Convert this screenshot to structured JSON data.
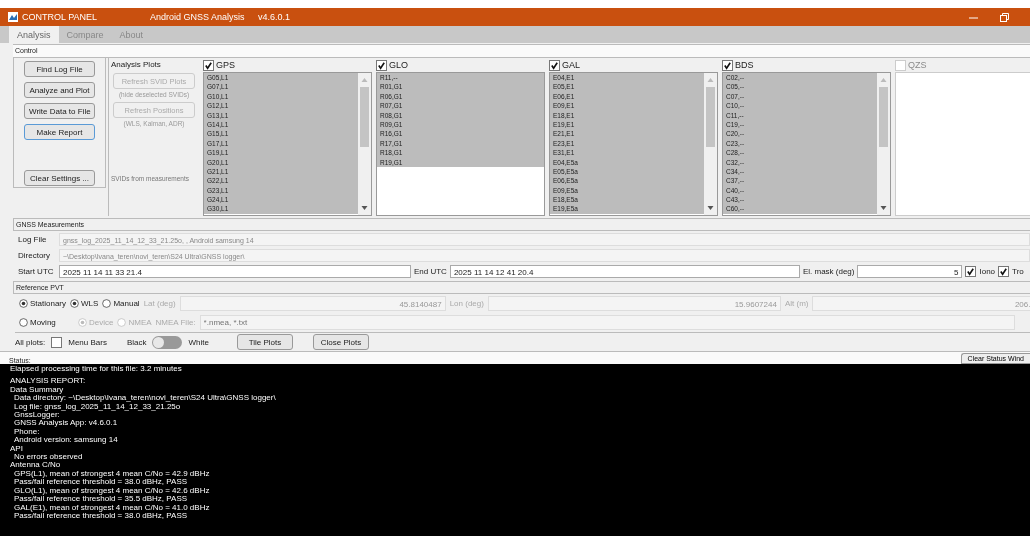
{
  "window": {
    "app": "CONTROL PANEL",
    "title": "Android GNSS Analysis",
    "version": "v4.6.0.1"
  },
  "tabs": [
    {
      "label": "Analysis",
      "selected": true
    },
    {
      "label": "Compare",
      "selected": false
    },
    {
      "label": "About",
      "selected": false
    }
  ],
  "control": {
    "title": "Control",
    "buttons": [
      {
        "label": "Find Log File",
        "focused": false
      },
      {
        "label": "Analyze and Plot",
        "focused": false
      },
      {
        "label": "Write Data to File",
        "focused": false
      },
      {
        "label": "Make Report",
        "focused": true
      }
    ],
    "clear_button": "Clear Settings ...",
    "analysis_plots": {
      "title": "Analysis Plots",
      "buttons": [
        {
          "label": "Refresh SVID Plots",
          "note": "(hide deselected SVIDs)",
          "disabled": true
        },
        {
          "label": "Refresh Positions",
          "note": "(WLS, Kalman, ADR)",
          "disabled": true
        }
      ],
      "footer": "SVIDs from measurements"
    },
    "constellations": [
      {
        "name": "GPS",
        "checked": true,
        "disabled": false,
        "items": [
          {
            "label": "G05,L1",
            "selected": true
          },
          {
            "label": "G07,L1",
            "selected": true
          },
          {
            "label": "G10,L1",
            "selected": true
          },
          {
            "label": "G12,L1",
            "selected": true
          },
          {
            "label": "G13,L1",
            "selected": true
          },
          {
            "label": "G14,L1",
            "selected": true
          },
          {
            "label": "G15,L1",
            "selected": true
          },
          {
            "label": "G17,L1",
            "selected": true
          },
          {
            "label": "G19,L1",
            "selected": true
          },
          {
            "label": "G20,L1",
            "selected": true
          },
          {
            "label": "G21,L1",
            "selected": true
          },
          {
            "label": "G22,L1",
            "selected": true
          },
          {
            "label": "G23,L1",
            "selected": true
          },
          {
            "label": "G24,L1",
            "selected": true
          },
          {
            "label": "G30,L1",
            "selected": true
          }
        ]
      },
      {
        "name": "GLO",
        "checked": true,
        "disabled": false,
        "items": [
          {
            "label": "R11,--",
            "selected": true
          },
          {
            "label": "R01,G1",
            "selected": true
          },
          {
            "label": "R06,G1",
            "selected": true
          },
          {
            "label": "R07,G1",
            "selected": true
          },
          {
            "label": "R08,G1",
            "selected": true
          },
          {
            "label": "R09,G1",
            "selected": true
          },
          {
            "label": "R16,G1",
            "selected": true
          },
          {
            "label": "R17,G1",
            "selected": true
          },
          {
            "label": "R18,G1",
            "selected": true
          },
          {
            "label": "R19,G1",
            "selected": true
          }
        ]
      },
      {
        "name": "GAL",
        "checked": true,
        "disabled": false,
        "items": [
          {
            "label": "E04,E1",
            "selected": true
          },
          {
            "label": "E05,E1",
            "selected": true
          },
          {
            "label": "E06,E1",
            "selected": true
          },
          {
            "label": "E09,E1",
            "selected": true
          },
          {
            "label": "E18,E1",
            "selected": true
          },
          {
            "label": "E19,E1",
            "selected": true
          },
          {
            "label": "E21,E1",
            "selected": true
          },
          {
            "label": "E23,E1",
            "selected": true
          },
          {
            "label": "E31,E1",
            "selected": true
          },
          {
            "label": "E04,E5a",
            "selected": true
          },
          {
            "label": "E05,E5a",
            "selected": true
          },
          {
            "label": "E06,E5a",
            "selected": true
          },
          {
            "label": "E09,E5a",
            "selected": true
          },
          {
            "label": "E18,E5a",
            "selected": true
          },
          {
            "label": "E19,E5a",
            "selected": true
          }
        ]
      },
      {
        "name": "BDS",
        "checked": true,
        "disabled": false,
        "items": [
          {
            "label": "C02,--",
            "selected": true
          },
          {
            "label": "C05,--",
            "selected": true
          },
          {
            "label": "C07,--",
            "selected": true
          },
          {
            "label": "C10,--",
            "selected": true
          },
          {
            "label": "C11,--",
            "selected": true
          },
          {
            "label": "C19,--",
            "selected": true
          },
          {
            "label": "C20,--",
            "selected": true
          },
          {
            "label": "C23,--",
            "selected": true
          },
          {
            "label": "C28,--",
            "selected": true
          },
          {
            "label": "C32,--",
            "selected": true
          },
          {
            "label": "C34,--",
            "selected": true
          },
          {
            "label": "C37,--",
            "selected": true
          },
          {
            "label": "C40,--",
            "selected": true
          },
          {
            "label": "C43,--",
            "selected": true
          },
          {
            "label": "C60,--",
            "selected": true
          }
        ]
      },
      {
        "name": "QZS",
        "checked": false,
        "disabled": true
      }
    ]
  },
  "measurements": {
    "title": "GNSS Measurements",
    "log_file": {
      "label": "Log File",
      "value": "gnss_log_2025_11_14_12_33_21.25o, , Android samsung 14",
      "disabled": true
    },
    "directory": {
      "label": "Directory",
      "value": "~\\Desktop\\Ivana_teren\\novi_teren\\S24 Ultra\\GNSS logger\\",
      "disabled": true
    },
    "start": {
      "label": "Start UTC",
      "value": "2025 11 14 11 33 21.4",
      "disabled": false
    },
    "end": {
      "label": "End UTC",
      "value": "2025 11 14 12 41 20.4",
      "disabled": false
    },
    "el_mask": {
      "label": "El. mask (deg)",
      "value": "5",
      "disabled": false
    },
    "checks": [
      {
        "label": "Iono",
        "checked": true
      },
      {
        "label": "Tro",
        "checked": true
      }
    ]
  },
  "reference_pvt": {
    "title": "Reference PVT",
    "mode": [
      {
        "label": "Stationary",
        "selected": true
      },
      {
        "label": "Moving",
        "selected": false
      }
    ],
    "source": [
      {
        "label": "WLS",
        "selected": true
      },
      {
        "label": "Manual",
        "selected": false
      }
    ],
    "nmea_source": [
      {
        "label": "Device",
        "selected": true,
        "disabled": true
      },
      {
        "label": "NMEA",
        "selected": false,
        "disabled": true
      }
    ],
    "coords": [
      {
        "label": "Lat (deg)",
        "value": "45.8140487"
      },
      {
        "label": "Lon (deg)",
        "value": "15.9607244"
      },
      {
        "label": "Alt (m)",
        "value": "206."
      }
    ],
    "nmea_file": {
      "label": "NMEA File:",
      "placeholder": "*.nmea, *.txt"
    }
  },
  "plots_bar": {
    "label": "All plots:",
    "menu_bars": {
      "label": "Menu Bars",
      "checked": false
    },
    "theme_switch": {
      "left": "Black",
      "right": "White",
      "on": false
    },
    "buttons": [
      "Tile Plots",
      "Close Plots"
    ]
  },
  "status": {
    "label": "Status:",
    "clear_button": "Clear Status Wind",
    "blocks": [
      {
        "lines": [
          {
            "text": "Elapsed processing time for this file: 3.2 minutes",
            "indented": false
          }
        ]
      },
      {
        "lines": [
          {
            "text": "ANALYSIS REPORT:",
            "indented": false
          },
          {
            "text": "Data Summary",
            "indented": false
          },
          {
            "text": "Data directory: ~\\Desktop\\Ivana_teren\\novi_teren\\S24 Ultra\\GNSS logger\\",
            "indented": true
          },
          {
            "text": "Log file: gnss_log_2025_11_14_12_33_21.25o",
            "indented": true
          },
          {
            "text": "GnssLogger:",
            "indented": true
          },
          {
            "text": "GNSS Analysis App: v4.6.0.1",
            "indented": true
          },
          {
            "text": "Phone:",
            "indented": true
          },
          {
            "text": "Android version: samsung 14",
            "indented": true
          },
          {
            "text": "API",
            "indented": false
          },
          {
            "text": "No errors observed",
            "indented": true
          },
          {
            "text": "Antenna C/No",
            "indented": false
          },
          {
            "text": "GPS(L1), mean of strongest 4 mean C/No = 42.9 dBHz",
            "indented": true
          },
          {
            "text": "Pass/fail reference threshold = 38.0 dBHz, PASS",
            "indented": true
          },
          {
            "text": "GLO(L1), mean of strongest 4 mean C/No = 42.6 dBHz",
            "indented": true
          },
          {
            "text": "Pass/fail reference threshold = 35.5 dBHz, PASS",
            "indented": true
          },
          {
            "text": "GAL(E1), mean of strongest 4 mean C/No = 41.0 dBHz",
            "indented": true
          },
          {
            "text": "Pass/fail reference threshold = 38.0 dBHz, PASS",
            "indented": true
          }
        ]
      }
    ]
  }
}
